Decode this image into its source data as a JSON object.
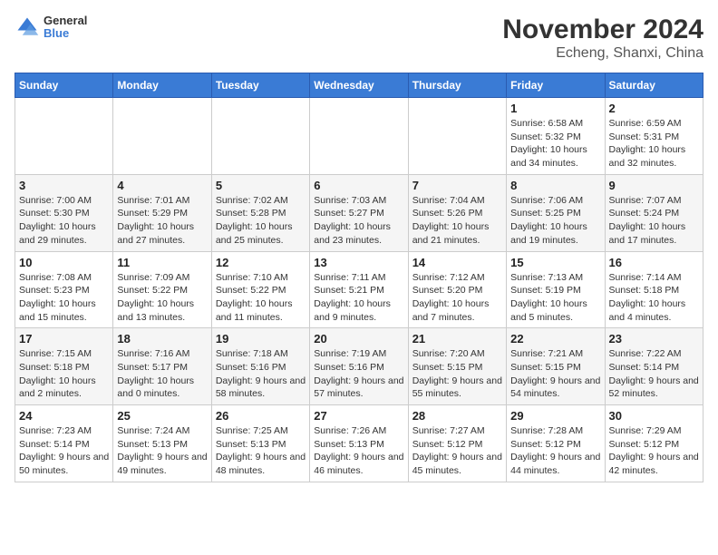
{
  "header": {
    "logo_line1": "General",
    "logo_line2": "Blue",
    "title": "November 2024",
    "subtitle": "Echeng, Shanxi, China"
  },
  "days_of_week": [
    "Sunday",
    "Monday",
    "Tuesday",
    "Wednesday",
    "Thursday",
    "Friday",
    "Saturday"
  ],
  "weeks": [
    [
      {
        "day": "",
        "info": ""
      },
      {
        "day": "",
        "info": ""
      },
      {
        "day": "",
        "info": ""
      },
      {
        "day": "",
        "info": ""
      },
      {
        "day": "",
        "info": ""
      },
      {
        "day": "1",
        "info": "Sunrise: 6:58 AM\nSunset: 5:32 PM\nDaylight: 10 hours and 34 minutes."
      },
      {
        "day": "2",
        "info": "Sunrise: 6:59 AM\nSunset: 5:31 PM\nDaylight: 10 hours and 32 minutes."
      }
    ],
    [
      {
        "day": "3",
        "info": "Sunrise: 7:00 AM\nSunset: 5:30 PM\nDaylight: 10 hours and 29 minutes."
      },
      {
        "day": "4",
        "info": "Sunrise: 7:01 AM\nSunset: 5:29 PM\nDaylight: 10 hours and 27 minutes."
      },
      {
        "day": "5",
        "info": "Sunrise: 7:02 AM\nSunset: 5:28 PM\nDaylight: 10 hours and 25 minutes."
      },
      {
        "day": "6",
        "info": "Sunrise: 7:03 AM\nSunset: 5:27 PM\nDaylight: 10 hours and 23 minutes."
      },
      {
        "day": "7",
        "info": "Sunrise: 7:04 AM\nSunset: 5:26 PM\nDaylight: 10 hours and 21 minutes."
      },
      {
        "day": "8",
        "info": "Sunrise: 7:06 AM\nSunset: 5:25 PM\nDaylight: 10 hours and 19 minutes."
      },
      {
        "day": "9",
        "info": "Sunrise: 7:07 AM\nSunset: 5:24 PM\nDaylight: 10 hours and 17 minutes."
      }
    ],
    [
      {
        "day": "10",
        "info": "Sunrise: 7:08 AM\nSunset: 5:23 PM\nDaylight: 10 hours and 15 minutes."
      },
      {
        "day": "11",
        "info": "Sunrise: 7:09 AM\nSunset: 5:22 PM\nDaylight: 10 hours and 13 minutes."
      },
      {
        "day": "12",
        "info": "Sunrise: 7:10 AM\nSunset: 5:22 PM\nDaylight: 10 hours and 11 minutes."
      },
      {
        "day": "13",
        "info": "Sunrise: 7:11 AM\nSunset: 5:21 PM\nDaylight: 10 hours and 9 minutes."
      },
      {
        "day": "14",
        "info": "Sunrise: 7:12 AM\nSunset: 5:20 PM\nDaylight: 10 hours and 7 minutes."
      },
      {
        "day": "15",
        "info": "Sunrise: 7:13 AM\nSunset: 5:19 PM\nDaylight: 10 hours and 5 minutes."
      },
      {
        "day": "16",
        "info": "Sunrise: 7:14 AM\nSunset: 5:18 PM\nDaylight: 10 hours and 4 minutes."
      }
    ],
    [
      {
        "day": "17",
        "info": "Sunrise: 7:15 AM\nSunset: 5:18 PM\nDaylight: 10 hours and 2 minutes."
      },
      {
        "day": "18",
        "info": "Sunrise: 7:16 AM\nSunset: 5:17 PM\nDaylight: 10 hours and 0 minutes."
      },
      {
        "day": "19",
        "info": "Sunrise: 7:18 AM\nSunset: 5:16 PM\nDaylight: 9 hours and 58 minutes."
      },
      {
        "day": "20",
        "info": "Sunrise: 7:19 AM\nSunset: 5:16 PM\nDaylight: 9 hours and 57 minutes."
      },
      {
        "day": "21",
        "info": "Sunrise: 7:20 AM\nSunset: 5:15 PM\nDaylight: 9 hours and 55 minutes."
      },
      {
        "day": "22",
        "info": "Sunrise: 7:21 AM\nSunset: 5:15 PM\nDaylight: 9 hours and 54 minutes."
      },
      {
        "day": "23",
        "info": "Sunrise: 7:22 AM\nSunset: 5:14 PM\nDaylight: 9 hours and 52 minutes."
      }
    ],
    [
      {
        "day": "24",
        "info": "Sunrise: 7:23 AM\nSunset: 5:14 PM\nDaylight: 9 hours and 50 minutes."
      },
      {
        "day": "25",
        "info": "Sunrise: 7:24 AM\nSunset: 5:13 PM\nDaylight: 9 hours and 49 minutes."
      },
      {
        "day": "26",
        "info": "Sunrise: 7:25 AM\nSunset: 5:13 PM\nDaylight: 9 hours and 48 minutes."
      },
      {
        "day": "27",
        "info": "Sunrise: 7:26 AM\nSunset: 5:13 PM\nDaylight: 9 hours and 46 minutes."
      },
      {
        "day": "28",
        "info": "Sunrise: 7:27 AM\nSunset: 5:12 PM\nDaylight: 9 hours and 45 minutes."
      },
      {
        "day": "29",
        "info": "Sunrise: 7:28 AM\nSunset: 5:12 PM\nDaylight: 9 hours and 44 minutes."
      },
      {
        "day": "30",
        "info": "Sunrise: 7:29 AM\nSunset: 5:12 PM\nDaylight: 9 hours and 42 minutes."
      }
    ]
  ]
}
